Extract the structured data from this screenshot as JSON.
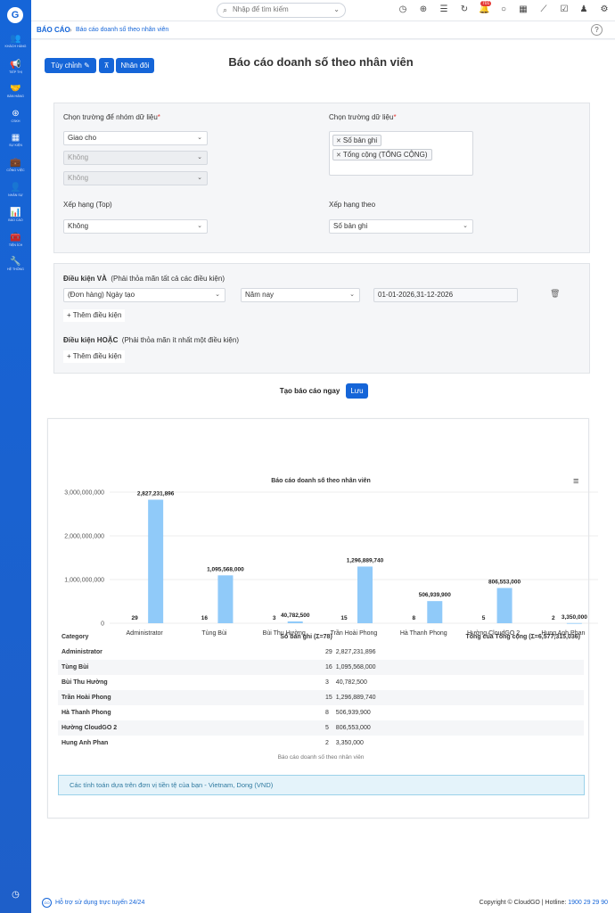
{
  "sidebar": {
    "logo": "G",
    "items": [
      {
        "label": "Khách hàng",
        "icon": "users-icon",
        "glyph": "👥"
      },
      {
        "label": "Tiếp thị",
        "icon": "megaphone-icon",
        "glyph": "📢"
      },
      {
        "label": "Bán hàng",
        "icon": "handshake-icon",
        "glyph": "🤝"
      },
      {
        "label": "CSKH",
        "icon": "support-icon",
        "glyph": "⊛"
      },
      {
        "label": "Sự kiện",
        "icon": "calendar-icon",
        "glyph": "▦"
      },
      {
        "label": "Công việc",
        "icon": "briefcase-icon",
        "glyph": "💼"
      },
      {
        "label": "Nhân sự",
        "icon": "person-icon",
        "glyph": "👤"
      },
      {
        "label": "Báo cáo",
        "icon": "chart-icon",
        "glyph": "📊"
      },
      {
        "label": "Tiện ích",
        "icon": "package-icon",
        "glyph": "🧰"
      },
      {
        "label": "Hệ thống",
        "icon": "wrench-icon",
        "glyph": "🔧"
      }
    ],
    "bottom_icon": "history-icon"
  },
  "topbar": {
    "search_placeholder": "Nhập để tìm kiếm",
    "notification_count": "701"
  },
  "breadcrumb": {
    "root": "BÁO CÁO",
    "current": "Báo cáo doanh số theo nhân viên"
  },
  "toolbar": {
    "customize_label": "Tùy chỉnh",
    "duplicate_label": "Nhân đôi"
  },
  "page_title": "Báo cáo doanh số theo nhân viên",
  "grouping": {
    "group_label": "Chọn trường để nhóm dữ liệu",
    "group_value": "Giao cho",
    "group2_value": "Không",
    "group3_value": "Không",
    "data_label": "Chọn trường dữ liệu",
    "data_tags": [
      "Số bản ghi",
      "Tổng cộng (TỔNG CỘNG)"
    ],
    "top_label": "Xếp hạng (Top)",
    "top_value": "Không",
    "rank_by_label": "Xếp hạng theo",
    "rank_by_value": "Số bản ghi",
    "required_mark": "*"
  },
  "conditions": {
    "and_title": "Điều kiện VÀ",
    "and_hint": "(Phải thỏa mãn tất cả các điều kiện)",
    "field": "(Đơn hàng) Ngày tạo",
    "operator": "Năm nay",
    "range": "01-01-2026,31-12-2026",
    "add_label": "Thêm điều kiện",
    "or_title": "Điều kiện HOẶC",
    "or_hint": "(Phải thỏa mãn ít nhất một điều kiện)",
    "or_add_label": "Thêm điều kiện"
  },
  "actions": {
    "generate_label": "Tạo báo cáo ngay",
    "save_label": "Lưu"
  },
  "colors": {
    "primary": "#1565d8",
    "bar": "#90caf9",
    "records_dot": "#4a90d9"
  },
  "chart_data": {
    "type": "bar",
    "title": "Báo cáo doanh số theo nhân viên",
    "categories": [
      "Administrator",
      "Tùng Bùi",
      "Bùi Thu Hường",
      "Trần Hoài Phong",
      "Hà Thanh Phong",
      "Hường CloudGO 2",
      "Hung Anh Phan"
    ],
    "series": [
      {
        "name": "Số bản ghi (Σ=78)",
        "values": [
          29,
          16,
          3,
          15,
          8,
          5,
          2
        ]
      },
      {
        "name": "Tổng của Tổng cộng (Σ=6,577,315,036)",
        "values": [
          2827231896,
          1095568000,
          40782500,
          1296889740,
          506939900,
          806553000,
          3350000
        ]
      }
    ],
    "value_labels": [
      "2,827,231,896",
      "1,095,568,000",
      "40,782,500",
      "1,296,889,740",
      "506,939,900",
      "806,553,000",
      "3,350,000"
    ],
    "yticks": [
      "0",
      "1,000,000,000",
      "2,000,000,000",
      "3,000,000,000"
    ],
    "ylim": [
      0,
      3000000000
    ],
    "legend_position": "bottom",
    "grid": true
  },
  "table": {
    "headers": [
      "Category",
      "Số bản ghi (Σ=78)",
      "Tổng của Tổng cộng (Σ=6,577,315,036)"
    ],
    "rows": [
      [
        "Administrator",
        "29",
        "2,827,231,896"
      ],
      [
        "Tùng Bùi",
        "16",
        "1,095,568,000"
      ],
      [
        "Bùi Thu Hường",
        "3",
        "40,782,500"
      ],
      [
        "Trần Hoài Phong",
        "15",
        "1,296,889,740"
      ],
      [
        "Hà Thanh Phong",
        "8",
        "506,939,900"
      ],
      [
        "Hường CloudGO 2",
        "5",
        "806,553,000"
      ],
      [
        "Hung Anh Phan",
        "2",
        "3,350,000"
      ]
    ],
    "caption": "Báo cáo doanh số theo nhân viên"
  },
  "notice": "Các tính toán dựa trên đơn vị tiền tệ của bạn - Vietnam, Dong (VND)",
  "footer": {
    "support": "Hỗ trợ sử dụng trực tuyến 24/24",
    "logo_text": "GO",
    "copyright": "Copyright © CloudGO | Hotline: ",
    "hotline": "1900 29 29 90"
  }
}
